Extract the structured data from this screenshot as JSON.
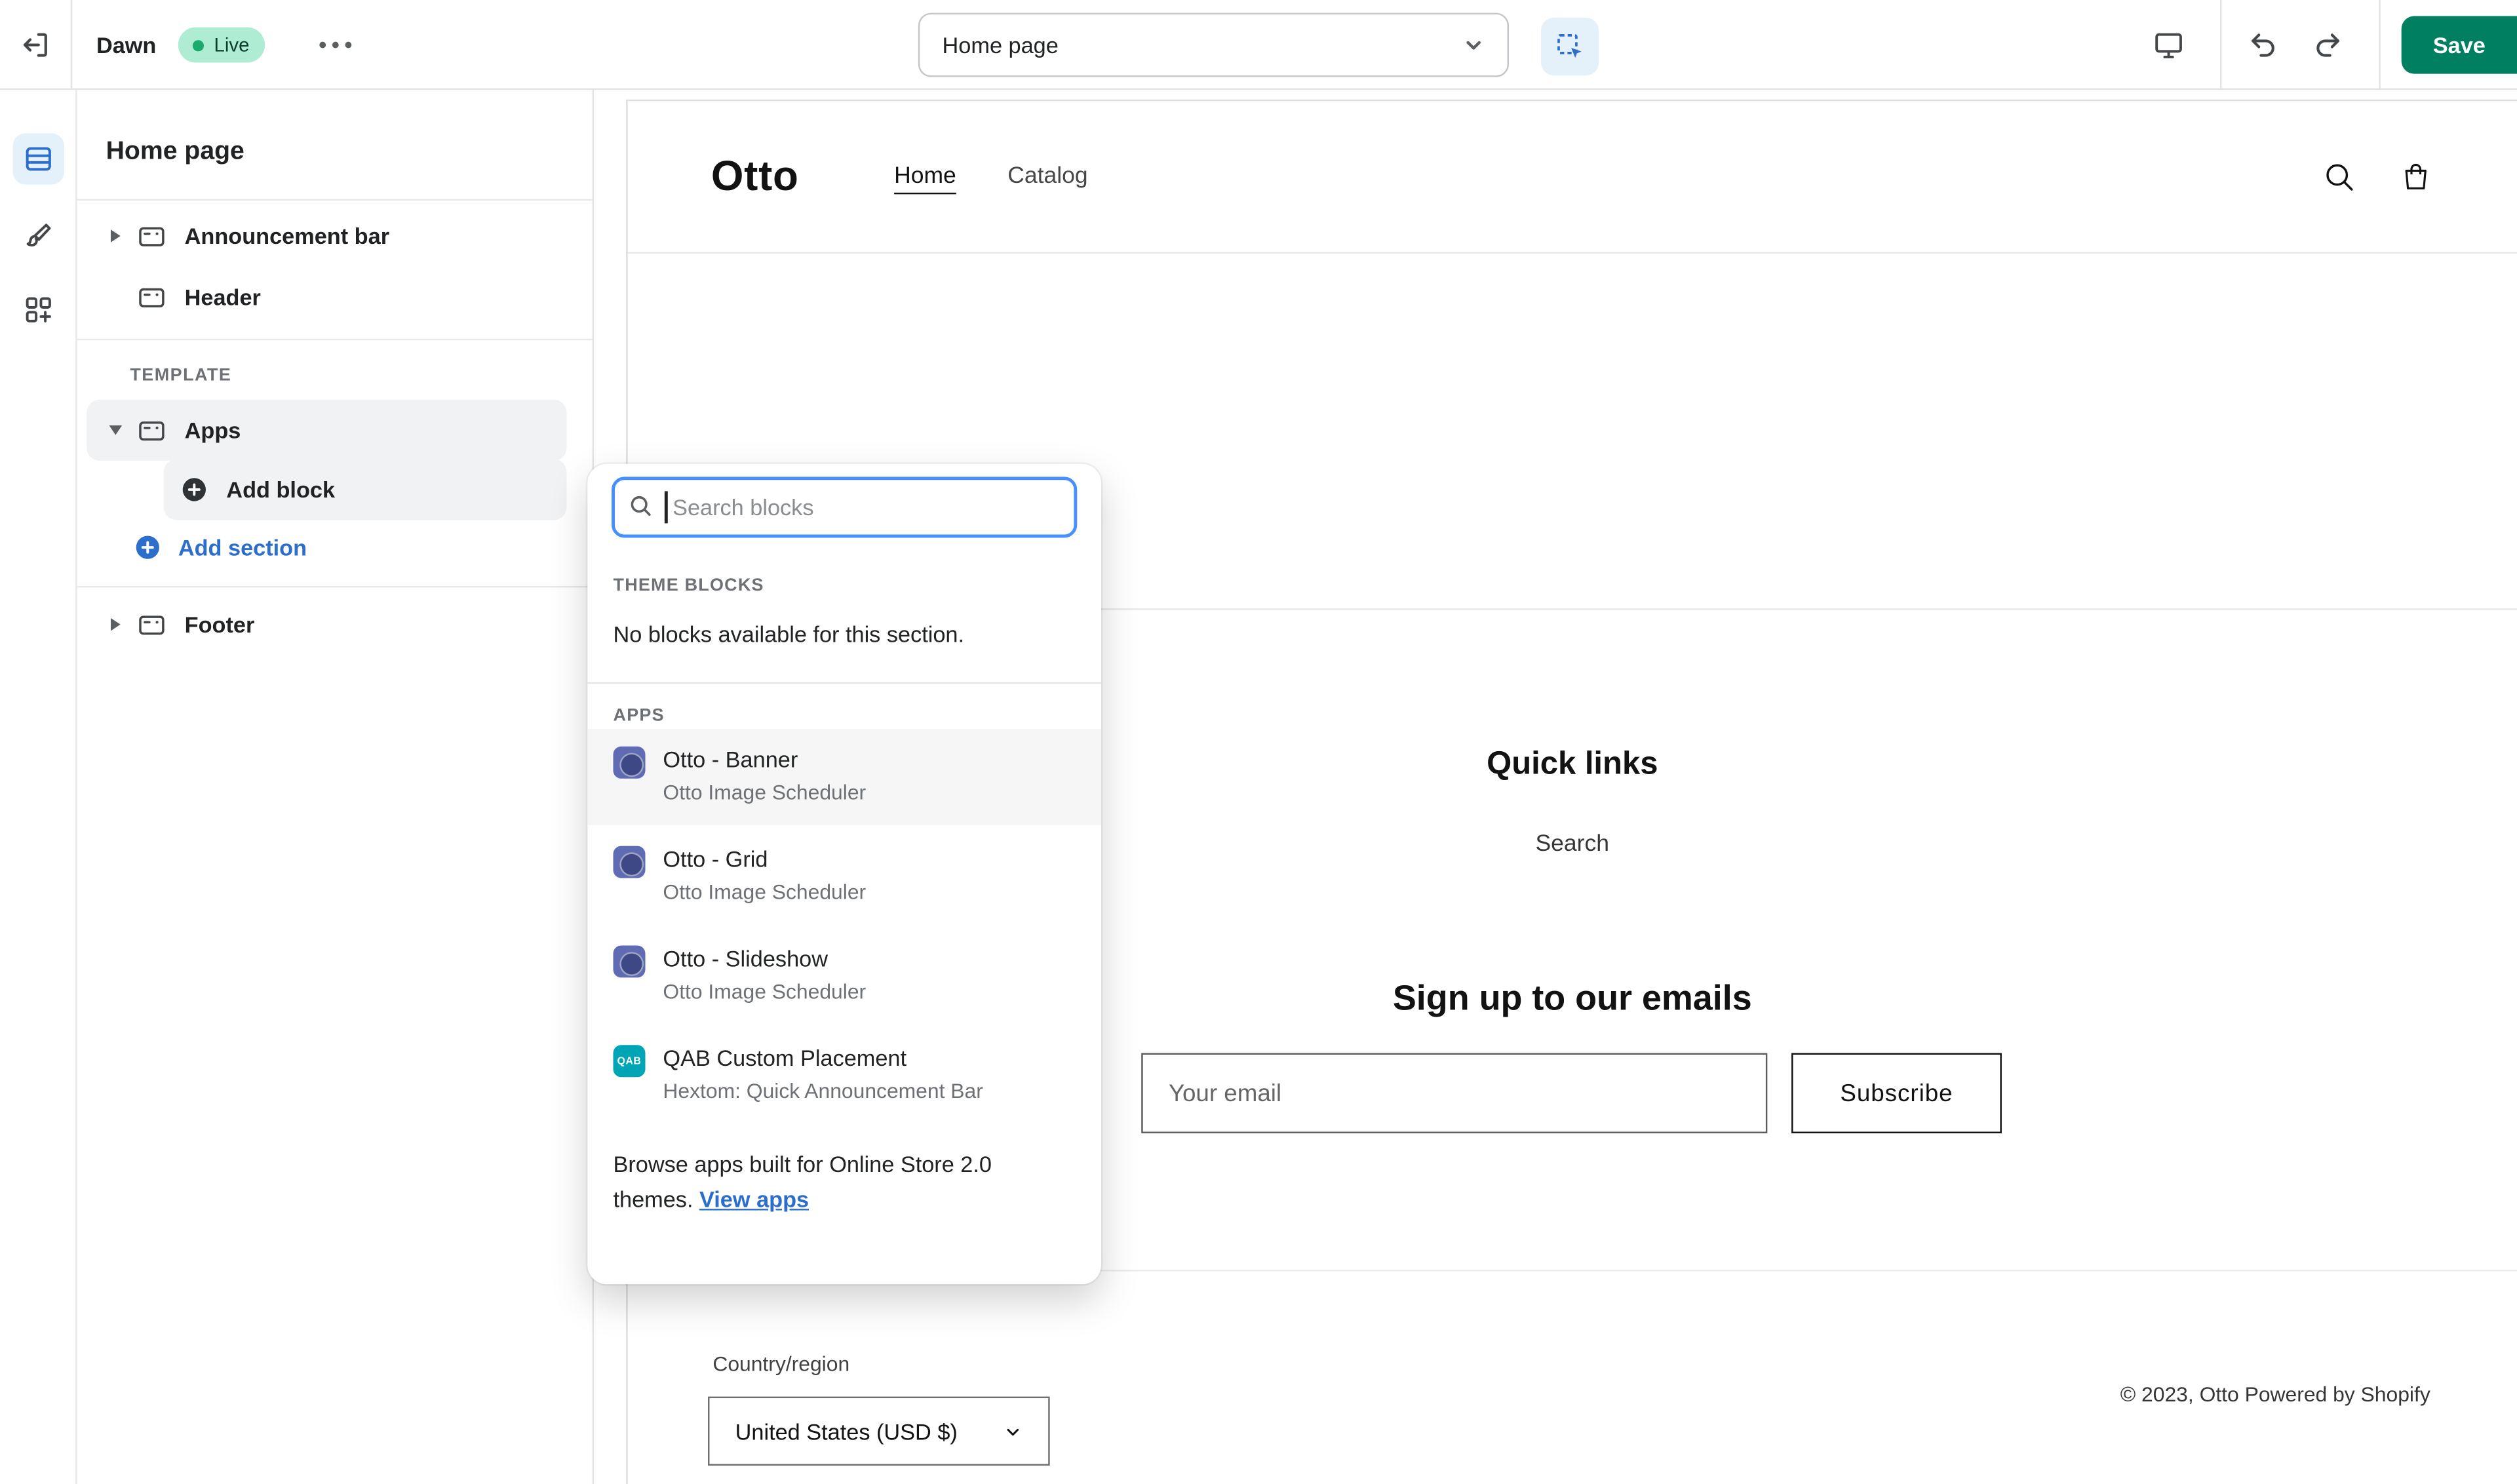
{
  "topbar": {
    "theme_name": "Dawn",
    "live_badge": "Live",
    "page_selector": "Home page",
    "save_label": "Save"
  },
  "sidebar": {
    "title": "Home page",
    "items": [
      {
        "label": "Announcement bar"
      },
      {
        "label": "Header"
      }
    ],
    "template_heading": "TEMPLATE",
    "apps_item": "Apps",
    "add_block_label": "Add block",
    "add_section_label": "Add section",
    "footer_item": "Footer"
  },
  "block_picker": {
    "search_placeholder": "Search blocks",
    "theme_blocks_heading": "THEME BLOCKS",
    "empty_message": "No blocks available for this section.",
    "apps_heading": "APPS",
    "apps": [
      {
        "title": "Otto - Banner",
        "subtitle": "Otto Image Scheduler"
      },
      {
        "title": "Otto - Grid",
        "subtitle": "Otto Image Scheduler"
      },
      {
        "title": "Otto - Slideshow",
        "subtitle": "Otto Image Scheduler"
      },
      {
        "title": "QAB Custom Placement",
        "subtitle": "Hextom: Quick Announcement Bar",
        "badge": "QAB"
      }
    ],
    "browse_text": "Browse apps built for Online Store 2.0 themes. ",
    "view_apps_label": "View apps"
  },
  "storefront": {
    "logo": "Otto",
    "nav": [
      {
        "label": "Home"
      },
      {
        "label": "Catalog"
      }
    ],
    "quick_links_heading": "Quick links",
    "quick_links": [
      {
        "label": "Search"
      }
    ],
    "newsletter_heading": "Sign up to our emails",
    "email_placeholder": "Your email",
    "subscribe_label": "Subscribe",
    "country_label": "Country/region",
    "country_value": "United States (USD $)",
    "copyright": "© 2023, Otto Powered by Shopify"
  },
  "colors": {
    "save_green": "#008060",
    "accent_blue": "#2C6ECB",
    "live_badge_bg": "#AFECD4",
    "focus_ring": "#458FFF",
    "otto_app_icon": "#5F6BB3",
    "qab_app_icon": "#00A5B5"
  }
}
